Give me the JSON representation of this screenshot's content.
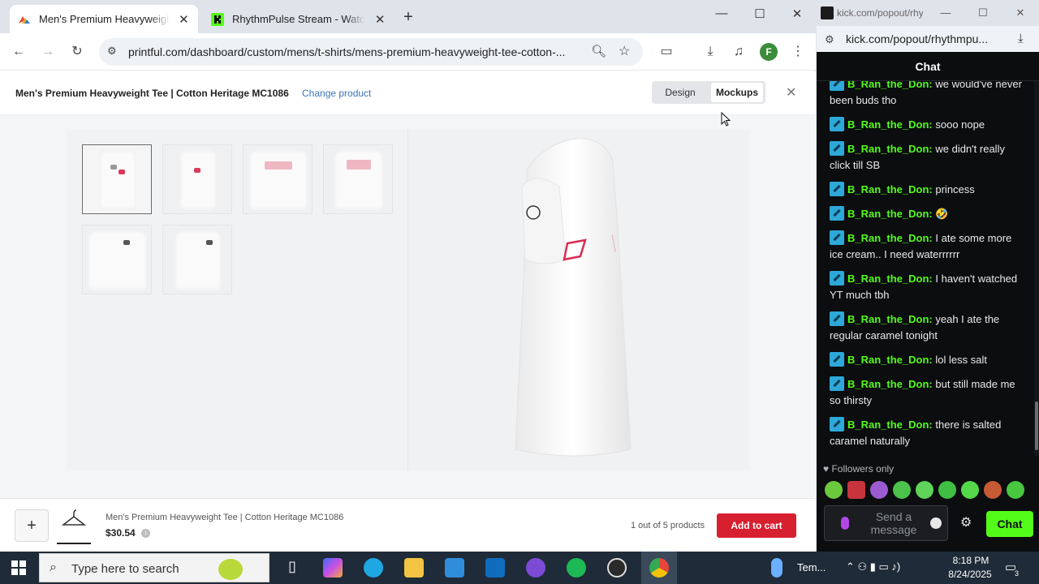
{
  "browser": {
    "tabs": [
      {
        "label": "Men's Premium Heavyweight Tee",
        "active": true
      },
      {
        "label": "RhythmPulse Stream - Watch Live",
        "active": false
      }
    ],
    "new_tab_glyph": "+",
    "url": "printful.com/dashboard/custom/mens/t-shirts/mens-premium-heavyweight-tee-cotton-...",
    "profile_initial": "F",
    "controls": {
      "minimize": "—",
      "maximize": "☐",
      "close": "✕"
    }
  },
  "page": {
    "product_title": "Men's Premium Heavyweight Tee | Cotton Heritage MC1086",
    "change_product": "Change product",
    "tabs": {
      "design": "Design",
      "mockups": "Mockups",
      "selected": "Mockups"
    },
    "close_glyph": "✕",
    "thumbnails_count": 6
  },
  "bottom_bar": {
    "add_glyph": "+",
    "product_name": "Men's Premium Heavyweight Tee | Cotton Heritage MC1086",
    "price": "$30.54",
    "info_glyph": "i",
    "product_count": "1 out of 5 products",
    "add_to_cart": "Add to cart"
  },
  "popout": {
    "title": "kick.com/popout/rhythmpulse/chat",
    "url": "kick.com/popout/rhythmpu...",
    "chat_header": "Chat",
    "messages": [
      {
        "user": "B_Ran_the_Don",
        "text": " we would've never been buds tho"
      },
      {
        "user": "B_Ran_the_Don",
        "text": " sooo nope"
      },
      {
        "user": "B_Ran_the_Don",
        "text": " we didn't really click till SB"
      },
      {
        "user": "B_Ran_the_Don",
        "text": " princess"
      },
      {
        "user": "B_Ran_the_Don",
        "text": " 🤣"
      },
      {
        "user": "B_Ran_the_Don",
        "text": " I ate some more ice cream.. I need waterrrrrr"
      },
      {
        "user": "B_Ran_the_Don",
        "text": " I haven't watched YT much tbh"
      },
      {
        "user": "B_Ran_the_Don",
        "text": " yeah I ate the regular caramel tonight"
      },
      {
        "user": "B_Ran_the_Don",
        "text": " lol less salt"
      },
      {
        "user": "B_Ran_the_Don",
        "text": " but still made me so thirsty"
      },
      {
        "user": "B_Ran_the_Don",
        "text": " there is salted caramel naturally"
      }
    ],
    "user_suffix": ":",
    "followers_only": "♥ Followers only",
    "input_placeholder": "Send a message",
    "chat_button": "Chat",
    "accent": "#53fc18"
  },
  "taskbar": {
    "search_placeholder": "Type here to search",
    "weather": "Tem...",
    "time": "8:18 PM",
    "date": "8/24/2025",
    "notification_count": "3"
  }
}
